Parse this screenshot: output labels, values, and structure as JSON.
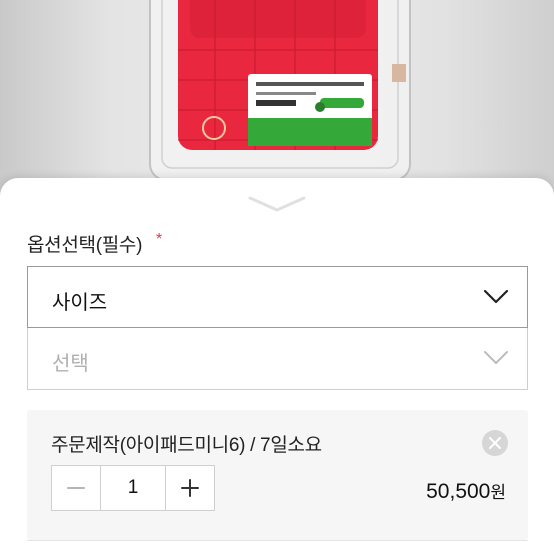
{
  "colors": {
    "accent": "#e8344e",
    "product": "#e9283f"
  },
  "option_sheet": {
    "title": "옵션선택(필수)",
    "required_mark": "*",
    "size_select": {
      "label": "사이즈"
    },
    "choice_select": {
      "placeholder": "선택"
    }
  },
  "selected_option": {
    "name": "주문제작(아이패드미니6) / 7일소요",
    "quantity": "1",
    "price_amount": "50,500",
    "price_unit": "원"
  },
  "icons": [
    "chevron-down-icon",
    "close-icon",
    "minus-icon",
    "plus-icon"
  ]
}
